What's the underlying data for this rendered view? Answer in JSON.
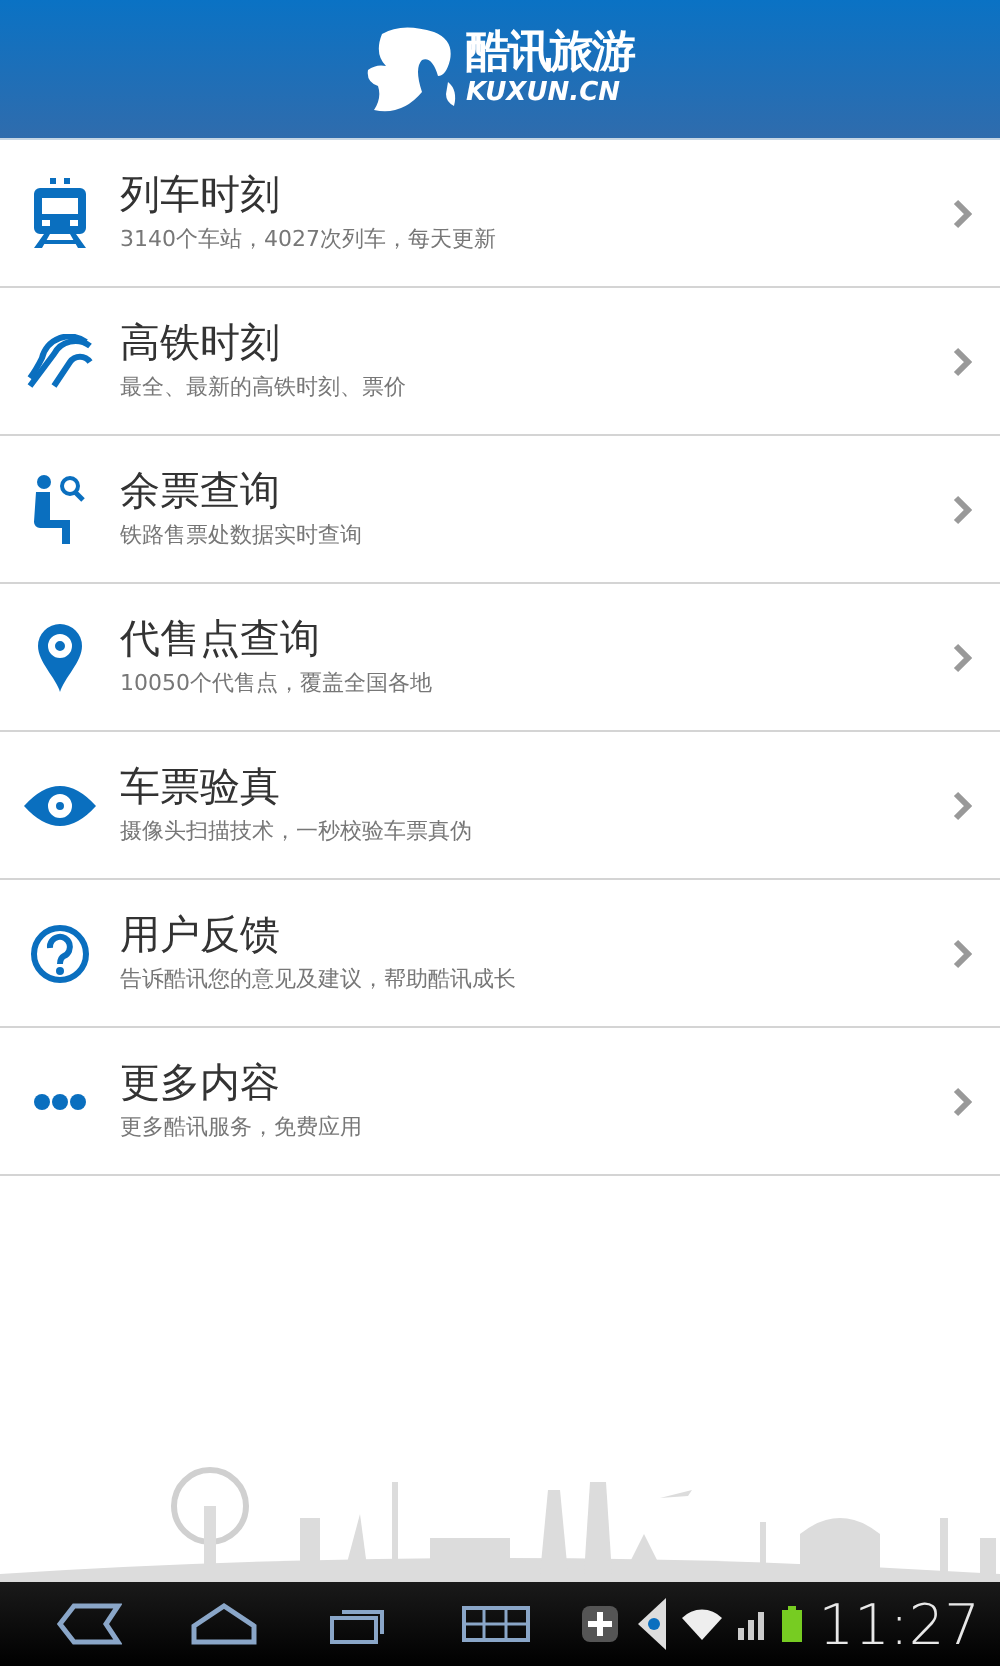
{
  "header": {
    "logo_title": "酷讯旅游",
    "logo_subtitle": "KUXUN.CN"
  },
  "menu": [
    {
      "kind": "train",
      "title": "列车时刻",
      "subtitle": "3140个车站，4027次列车，每天更新"
    },
    {
      "kind": "highspeed",
      "title": "高铁时刻",
      "subtitle": "最全、最新的高铁时刻、票价"
    },
    {
      "kind": "seat",
      "title": "余票查询",
      "subtitle": "铁路售票处数据实时查询"
    },
    {
      "kind": "pin",
      "title": "代售点查询",
      "subtitle": "10050个代售点，覆盖全国各地"
    },
    {
      "kind": "eye",
      "title": "车票验真",
      "subtitle": "摄像头扫描技术，一秒校验车票真伪"
    },
    {
      "kind": "question",
      "title": "用户反馈",
      "subtitle": "告诉酷讯您的意见及建议，帮助酷讯成长"
    },
    {
      "kind": "more",
      "title": "更多内容",
      "subtitle": "更多酷讯服务，免费应用"
    }
  ],
  "status_bar": {
    "time": "11:27"
  }
}
